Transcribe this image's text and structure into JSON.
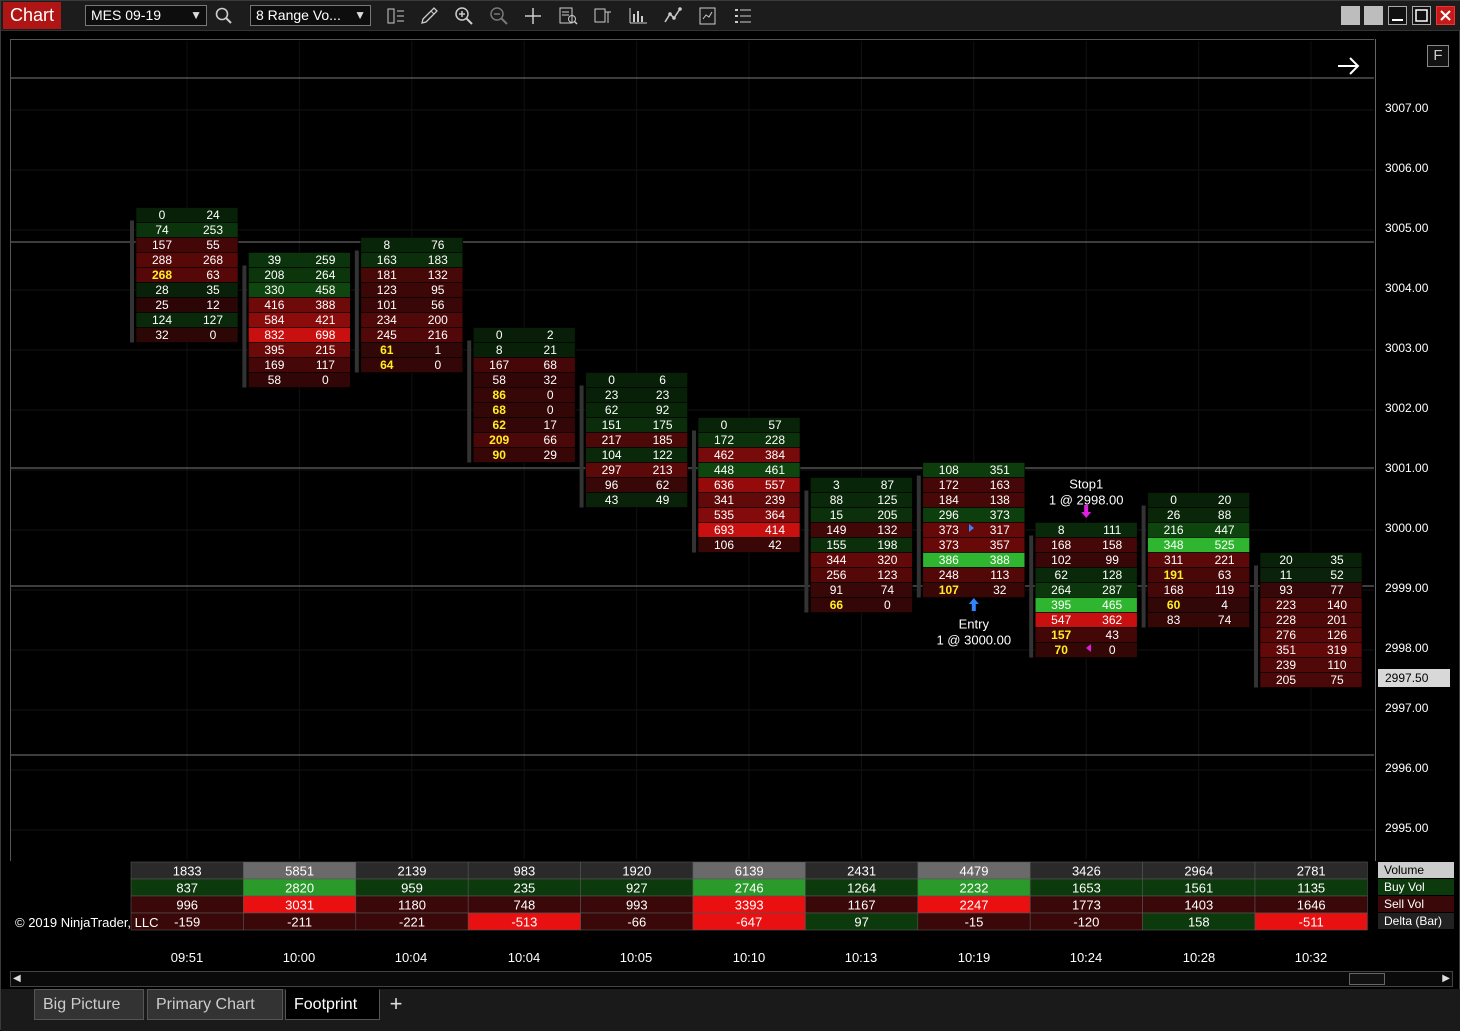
{
  "toolbar": {
    "chart_label": "Chart",
    "instrument": "MES 09-19",
    "bar_type": "8 Range Vo..."
  },
  "price_axis": {
    "labels": [
      "3007.00",
      "3006.00",
      "3005.00",
      "3004.00",
      "3003.00",
      "3002.00",
      "3001.00",
      "3000.00",
      "2999.00",
      "2998.00",
      "2997.00",
      "2996.00",
      "2995.00"
    ],
    "last_price": "2997.50"
  },
  "chart_data": {
    "type": "table",
    "tick_size": 0.25,
    "price_range": [
      2994.25,
      3007.75
    ],
    "bars": [
      {
        "time": "09:51",
        "top": 3005.25,
        "open": 3004.75,
        "close": 3003.75,
        "bid": [
          0,
          74,
          157,
          288,
          268,
          28,
          25,
          124,
          32
        ],
        "ask": [
          24,
          253,
          55,
          268,
          63,
          35,
          12,
          127,
          0
        ]
      },
      {
        "time": "10:00",
        "top": 3004.5,
        "open": 3004.5,
        "close": 3002.75,
        "bid": [
          39,
          208,
          330,
          416,
          584,
          832,
          395,
          169,
          58
        ],
        "ask": [
          259,
          264,
          458,
          388,
          421,
          698,
          215,
          117,
          0
        ]
      },
      {
        "time": "10:04",
        "top": 3004.75,
        "open": 3004.5,
        "close": 3003.0,
        "bid": [
          8,
          163,
          181,
          123,
          101,
          234,
          245,
          61,
          64
        ],
        "ask": [
          76,
          183,
          132,
          95,
          56,
          200,
          216,
          1,
          0
        ]
      },
      {
        "time": "10:04",
        "top": 3003.25,
        "open": 3003.0,
        "close": 3001.5,
        "bid": [
          0,
          8,
          167,
          58,
          86,
          68,
          62,
          209,
          90
        ],
        "ask": [
          2,
          21,
          68,
          32,
          0,
          0,
          17,
          66,
          29
        ]
      },
      {
        "time": "10:05",
        "top": 3002.5,
        "open": 3002.0,
        "close": 3000.5,
        "bid": [
          0,
          23,
          62,
          151,
          217,
          104,
          297,
          96,
          43
        ],
        "ask": [
          6,
          23,
          92,
          175,
          185,
          122,
          213,
          62,
          49
        ]
      },
      {
        "time": "10:10",
        "top": 3001.75,
        "open": 3001.5,
        "close": 2999.75,
        "bid": [
          0,
          172,
          462,
          448,
          636,
          341,
          535,
          693,
          106
        ],
        "ask": [
          57,
          228,
          384,
          461,
          557,
          239,
          364,
          414,
          42
        ]
      },
      {
        "time": "10:13",
        "top": 3000.75,
        "open": 3000.75,
        "close": 2998.75,
        "bid": [
          3,
          88,
          15,
          149,
          155,
          344,
          256,
          91,
          66
        ],
        "ask": [
          87,
          125,
          205,
          132,
          198,
          320,
          123,
          74,
          0
        ]
      },
      {
        "time": "10:19",
        "top": 3001.0,
        "open": 3001.0,
        "close": 2999.0,
        "bid": [
          108,
          172,
          184,
          296,
          373,
          373,
          386,
          248,
          107
        ],
        "ask": [
          351,
          163,
          138,
          373,
          317,
          357,
          388,
          113,
          32
        ]
      },
      {
        "time": "10:24",
        "top": 3000.0,
        "open": 3000.0,
        "close": 2998.25,
        "bid": [
          8,
          168,
          102,
          62,
          264,
          395,
          547,
          157,
          70
        ],
        "ask": [
          111,
          158,
          99,
          128,
          287,
          465,
          362,
          43,
          0
        ]
      },
      {
        "time": "10:28",
        "top": 3000.5,
        "open": 3000.0,
        "close": 2999.0,
        "bid": [
          0,
          26,
          216,
          348,
          311,
          191,
          168,
          60,
          83
        ],
        "ask": [
          20,
          88,
          447,
          525,
          221,
          63,
          119,
          4,
          74
        ]
      },
      {
        "time": "10:32",
        "top": 2999.5,
        "open": 2999.25,
        "close": 2997.5,
        "bid": [
          20,
          11,
          93,
          223,
          228,
          276,
          351,
          239,
          205
        ],
        "ask": [
          35,
          52,
          77,
          140,
          201,
          126,
          319,
          110,
          75
        ]
      }
    ],
    "summary_rows": [
      "Volume",
      "Buy Vol",
      "Sell Vol",
      "Delta (Bar)"
    ],
    "summary": {
      "volume": [
        1833,
        5851,
        2139,
        983,
        1920,
        6139,
        2431,
        4479,
        3426,
        2964,
        2781
      ],
      "buy_vol": [
        837,
        2820,
        959,
        235,
        927,
        2746,
        1264,
        2232,
        1653,
        1561,
        1135
      ],
      "sell_vol": [
        996,
        3031,
        1180,
        748,
        993,
        3393,
        1167,
        2247,
        1773,
        1403,
        1646
      ],
      "delta": [
        -159,
        -211,
        -221,
        -513,
        -66,
        -647,
        97,
        -15,
        -120,
        158,
        -511
      ]
    },
    "orders": [
      {
        "bar": 7,
        "price": 2999.0,
        "name": "Entry",
        "detail": "1 @ 3000.00",
        "color": "#2f86ff",
        "direction": "up"
      },
      {
        "bar": 8,
        "price": 3000.0,
        "name": "Stop1",
        "detail": "1 @ 2998.00",
        "color": "#e020e0",
        "direction": "down"
      }
    ]
  },
  "copyright": "© 2019 NinjaTrader, LLC",
  "tabs": [
    "Big Picture",
    "Primary Chart",
    "Footprint"
  ],
  "colors": {
    "chart_tag": "#b01515",
    "buy_strong": "#2fb52f",
    "sell_strong": "#c81010",
    "highlight": "#ffee22"
  }
}
